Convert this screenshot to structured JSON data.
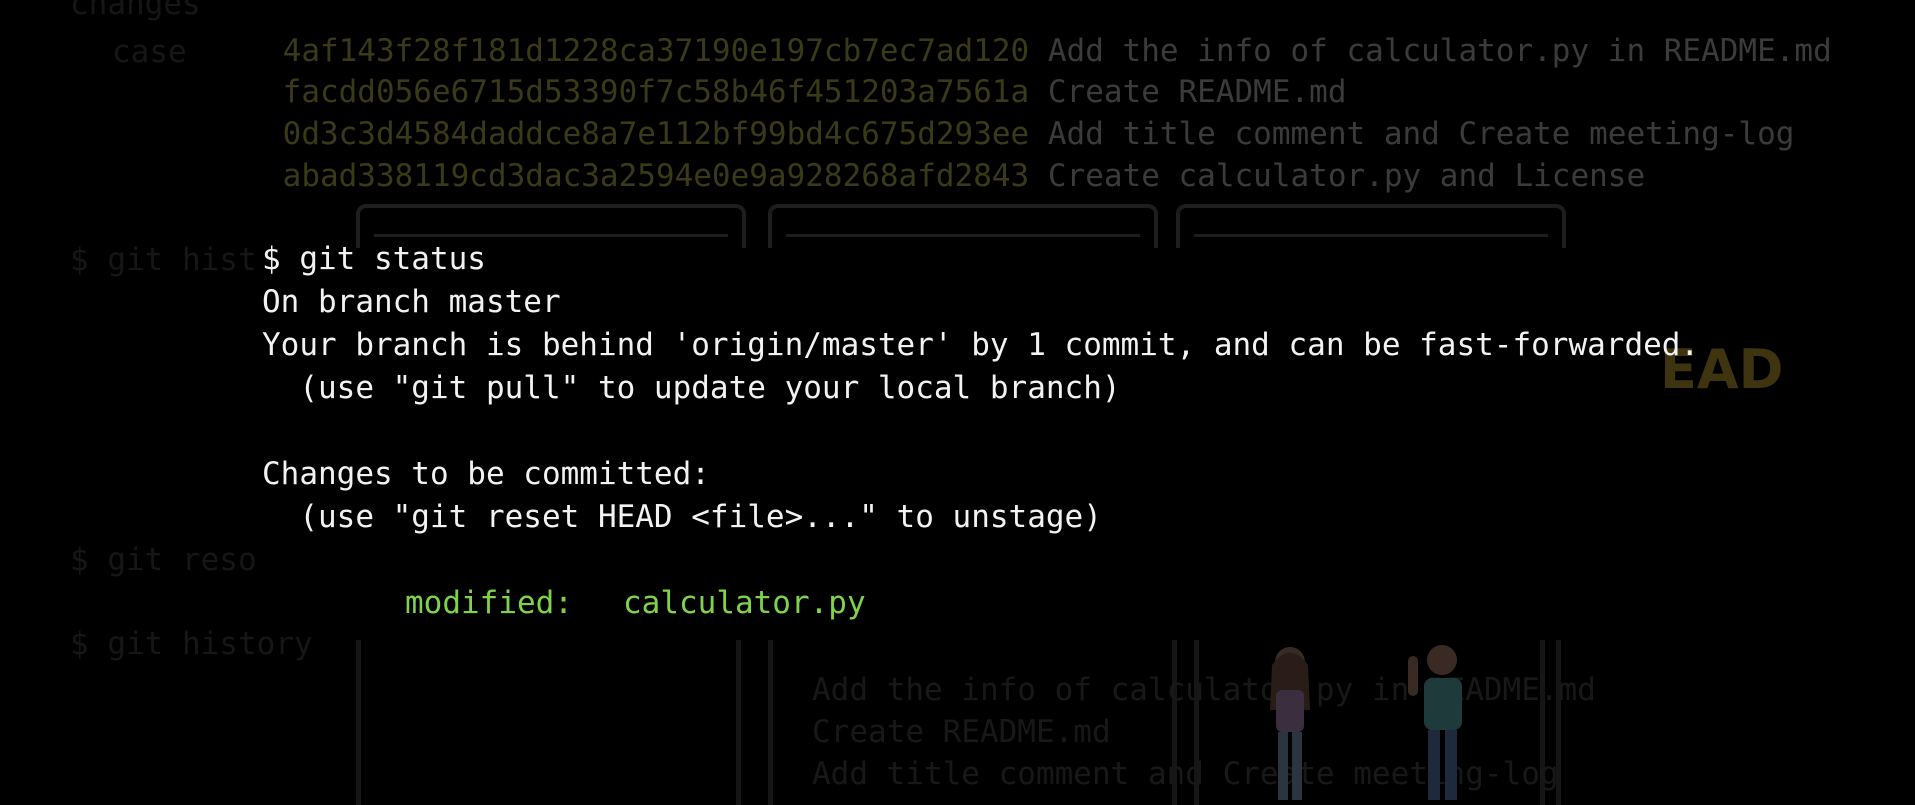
{
  "background": {
    "log_lines": [
      {
        "hash": "4af143f28f181d1228ca37190e197cb7ec7ad120",
        "message": "Add the info of calculator.py in README.md"
      },
      {
        "hash": "facdd056e6715d53390f7c58b46f451203a7561a",
        "message": "Create README.md"
      },
      {
        "hash": "0d3c3d4584daddce8a7e112bf99bd4c675d293ee",
        "message": "Add title comment and Create meeting-log"
      },
      {
        "hash": "abad338119cd3dac3a2594e0e9a928268afd2843",
        "message": "Create calculator.py and License"
      }
    ],
    "left_fragments": [
      "changes",
      "case",
      "$ git hist",
      "$ git reso",
      "$ git history"
    ],
    "head_label": "EAD",
    "bottom_lines": [
      "Add the info of calculator.py in README.md",
      "Create README.md",
      "Add title comment and Create meeting-log"
    ]
  },
  "terminal": {
    "command": "$ git status",
    "branch_line": "On branch master",
    "behind_line": "Your branch is behind 'origin/master' by 1 commit, and can be fast-forwarded.",
    "pull_hint": "  (use \"git pull\" to update your local branch)",
    "changes_header": "Changes to be committed:",
    "reset_hint": "  (use \"git reset HEAD <file>...\" to unstage)",
    "modified_label": "modified:",
    "modified_file": "calculator.py"
  },
  "colors": {
    "background": "#000000",
    "text": "#f2f2f2",
    "staged": "#7fd34a",
    "dim_hash": "#3a3a18"
  }
}
